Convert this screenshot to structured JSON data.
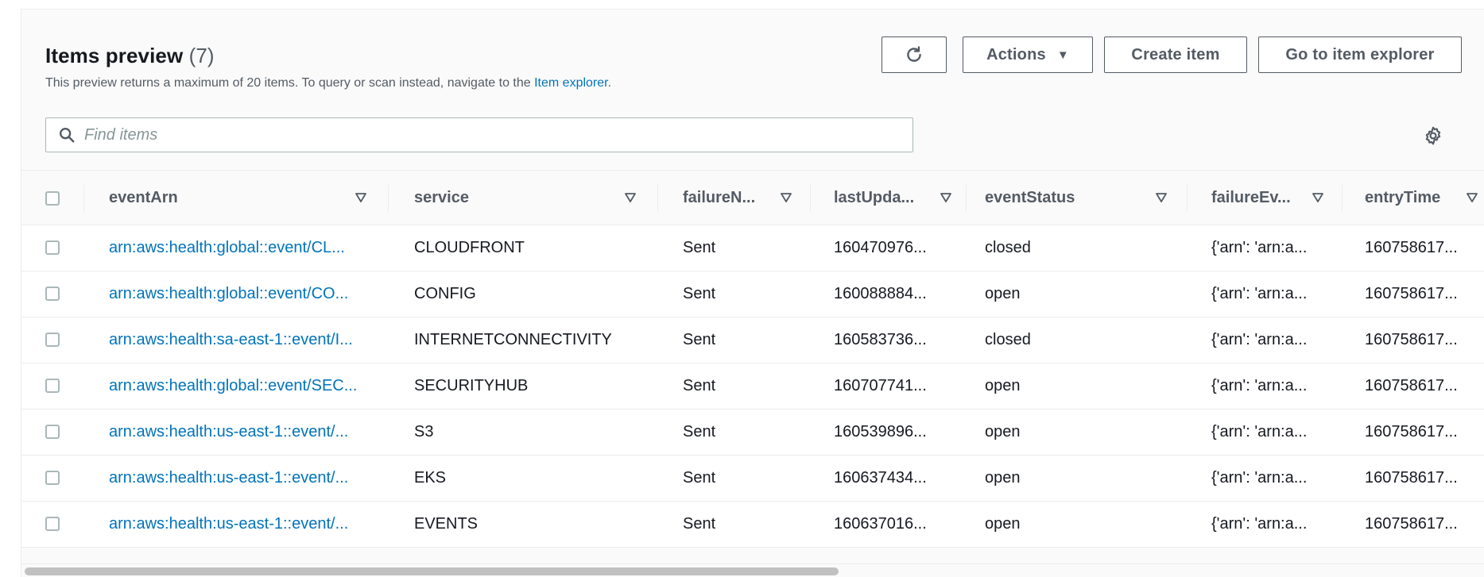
{
  "header": {
    "title": "Items preview",
    "count": "(7)",
    "subtitle_prefix": "This preview returns a maximum of 20 items. To query or scan instead, navigate to the ",
    "subtitle_link": "Item explorer",
    "subtitle_suffix": "."
  },
  "toolbar": {
    "refresh_icon": "refresh-icon",
    "actions_label": "Actions",
    "actions_caret": "▼",
    "create_label": "Create item",
    "explorer_label": "Go to item explorer"
  },
  "search": {
    "placeholder": "Find items",
    "value": ""
  },
  "table": {
    "columns": [
      "eventArn",
      "service",
      "failureN...",
      "lastUpda...",
      "eventStatus",
      "failureEv...",
      "entryTime"
    ],
    "rows": [
      [
        "arn:aws:health:global::event/CL...",
        "CLOUDFRONT",
        "Sent",
        "160470976...",
        "closed",
        "{'arn': 'arn:a...",
        "160758617..."
      ],
      [
        "arn:aws:health:global::event/CO...",
        "CONFIG",
        "Sent",
        "160088884...",
        "open",
        "{'arn': 'arn:a...",
        "160758617..."
      ],
      [
        "arn:aws:health:sa-east-1::event/I...",
        "INTERNETCONNECTIVITY",
        "Sent",
        "160583736...",
        "closed",
        "{'arn': 'arn:a...",
        "160758617..."
      ],
      [
        "arn:aws:health:global::event/SEC...",
        "SECURITYHUB",
        "Sent",
        "160707741...",
        "open",
        "{'arn': 'arn:a...",
        "160758617..."
      ],
      [
        "arn:aws:health:us-east-1::event/...",
        "S3",
        "Sent",
        "160539896...",
        "open",
        "{'arn': 'arn:a...",
        "160758617..."
      ],
      [
        "arn:aws:health:us-east-1::event/...",
        "EKS",
        "Sent",
        "160637434...",
        "open",
        "{'arn': 'arn:a...",
        "160758617..."
      ],
      [
        "arn:aws:health:us-east-1::event/...",
        "EVENTS",
        "Sent",
        "160637016...",
        "open",
        "{'arn': 'arn:a...",
        "160758617..."
      ]
    ]
  },
  "colors": {
    "link": "#0073bb",
    "text": "#16191f",
    "muted": "#545b64",
    "border": "#eaeded"
  }
}
